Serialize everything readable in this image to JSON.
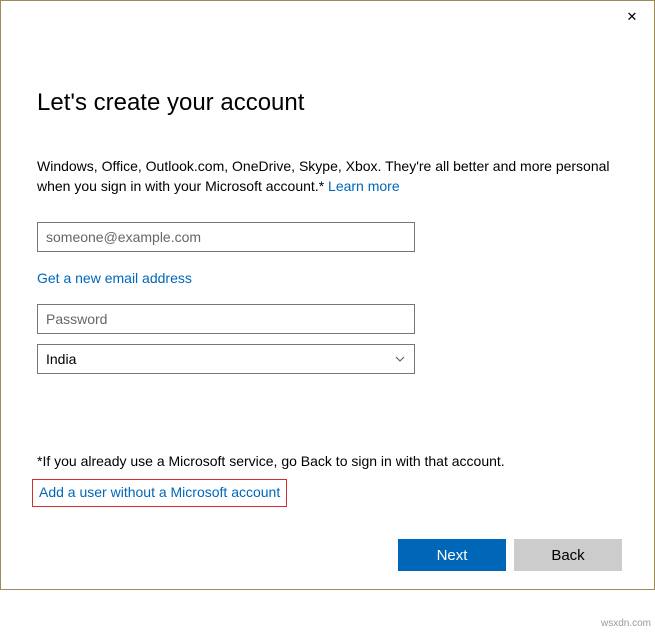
{
  "title": "Let's create your account",
  "description_text": "Windows, Office, Outlook.com, OneDrive, Skype, Xbox. They're all better and more personal when you sign in with your Microsoft account.*",
  "learn_more": "Learn more",
  "email": {
    "placeholder": "someone@example.com",
    "value": ""
  },
  "new_email_link": "Get a new email address",
  "password": {
    "placeholder": "Password",
    "value": ""
  },
  "country": {
    "selected": "India"
  },
  "footnote": "*If you already use a Microsoft service, go Back to sign in with that account.",
  "add_user_link": "Add a user without a Microsoft account",
  "buttons": {
    "next": "Next",
    "back": "Back"
  },
  "watermark": "wsxdn.com"
}
